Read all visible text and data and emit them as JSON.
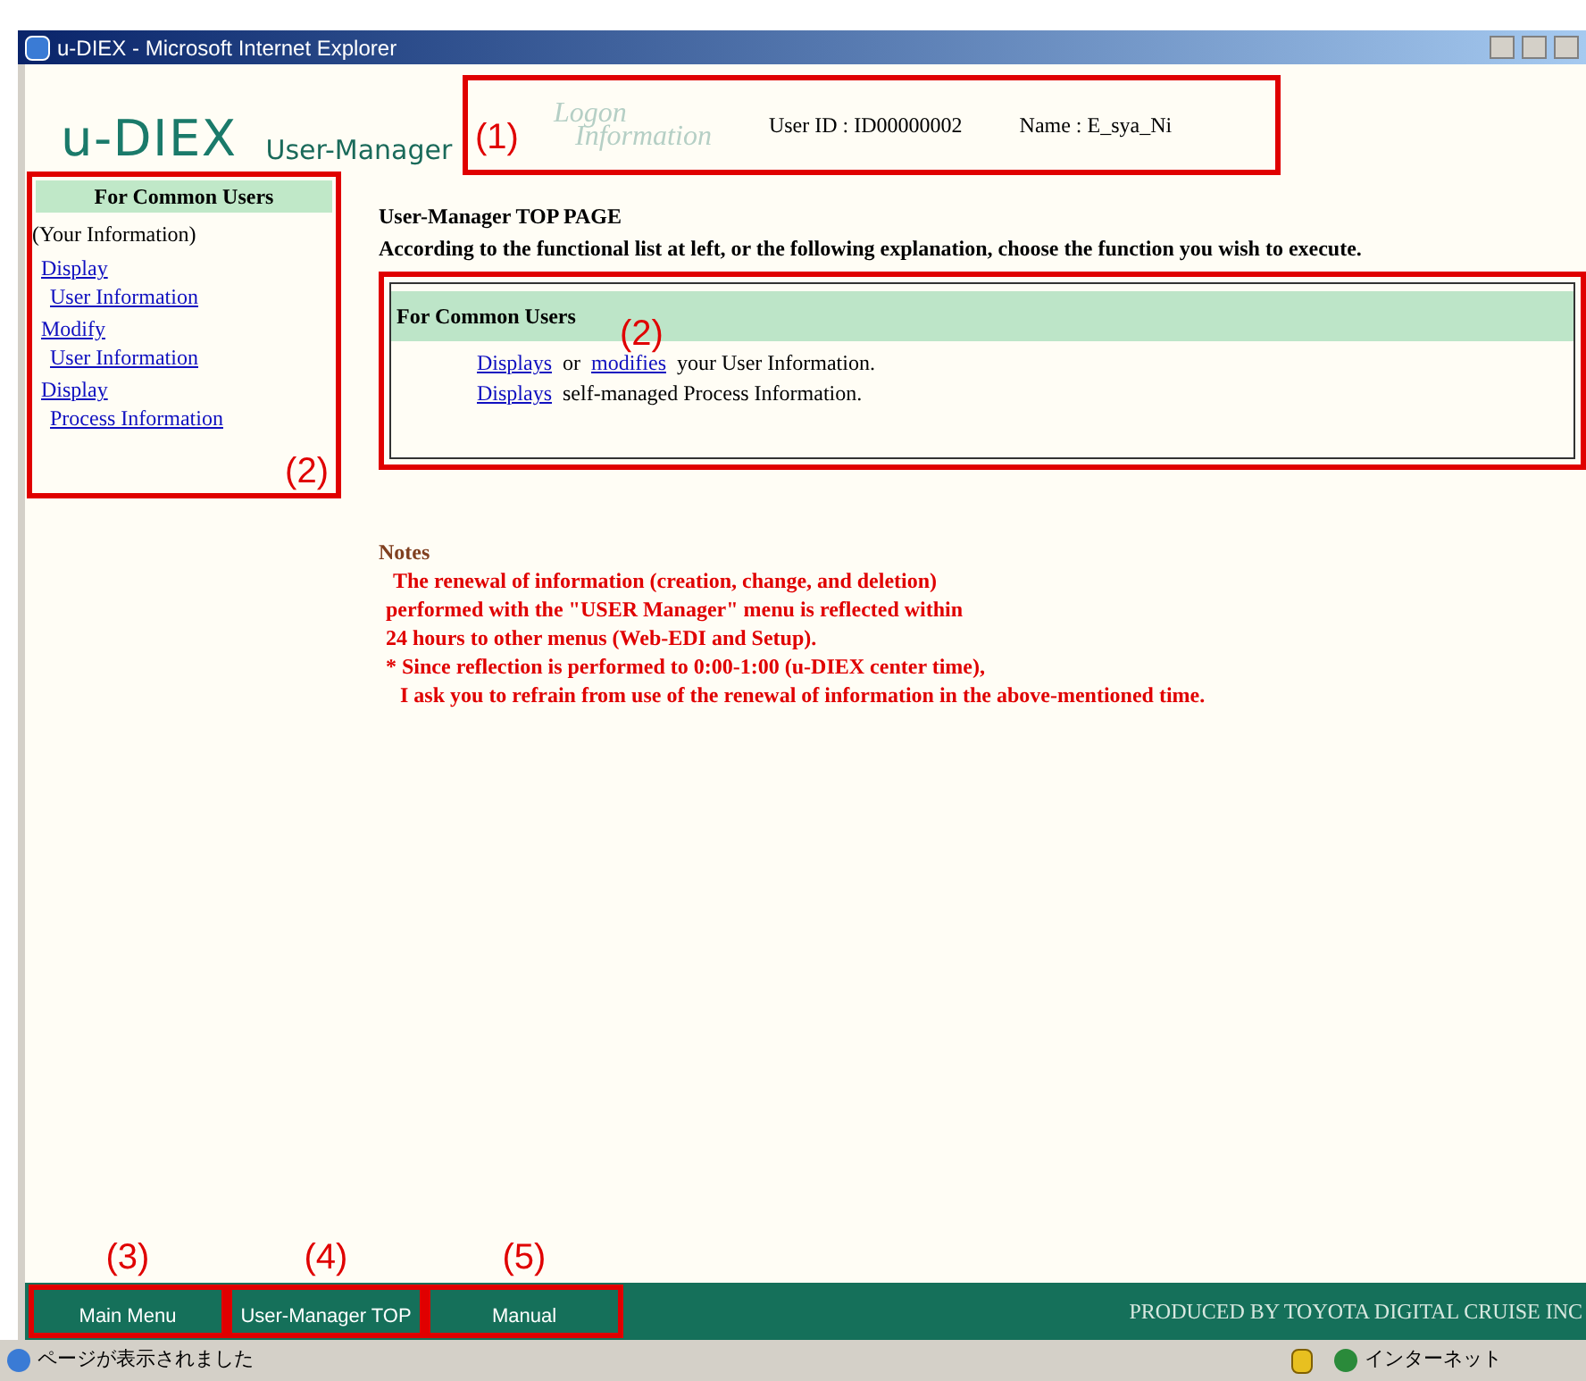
{
  "window": {
    "title": "u-DIEX - Microsoft Internet Explorer"
  },
  "header": {
    "logo": "u-DIEX",
    "subtitle": "User-Manager",
    "logon_label": [
      "Logon",
      "Information"
    ],
    "user_id": "User ID : ID00000002",
    "name": "Name : E_sya_Ni",
    "annotation": "(1)"
  },
  "sidebar": {
    "heading": "For Common Users",
    "group": "(Your Information)",
    "links": [
      {
        "verb": "Display",
        "object": "User Information"
      },
      {
        "verb": "Modify",
        "object": "User Information"
      },
      {
        "verb": "Display",
        "object": "Process Information"
      }
    ],
    "annotation": "(2)"
  },
  "main": {
    "title": "User-Manager  TOP PAGE",
    "instruction": "According to the functional list at left, or the following explanation, choose the function you wish to execute.",
    "panel": {
      "heading": "For Common Users",
      "annotation": "(2)",
      "lines": [
        [
          {
            "kind": "link",
            "text": "Displays"
          },
          {
            "kind": "text",
            "text": "or"
          },
          {
            "kind": "link",
            "text": "modifies"
          },
          {
            "kind": "text",
            "text": "your User Information."
          }
        ],
        [
          {
            "kind": "link",
            "text": "Displays"
          },
          {
            "kind": "text",
            "text": "self-managed Process Information."
          }
        ]
      ]
    },
    "notes": {
      "heading": "Notes",
      "lines": [
        "The renewal of information (creation, change, and deletion)",
        "performed with the \"USER Manager\" menu is reflected within",
        "24 hours to other menus (Web-EDI and Setup).",
        "* Since reflection is performed to 0:00-1:00 (u-DIEX center time),",
        "I ask you to refrain from use of the renewal of information in the above-mentioned time."
      ]
    }
  },
  "footer": {
    "buttons": [
      {
        "label": "Main Menu",
        "annotation": "(3)"
      },
      {
        "label": "User-Manager TOP",
        "annotation": "(4)"
      },
      {
        "label": "Manual",
        "annotation": "(5)"
      }
    ],
    "credit": "PRODUCED BY TOYOTA DIGITAL CRUISE INC"
  },
  "status_bar": {
    "text": "ページが表示されました",
    "zone": "インターネット"
  }
}
